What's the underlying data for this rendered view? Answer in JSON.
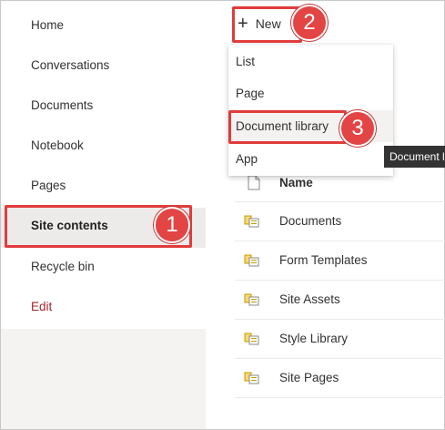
{
  "sidebar": {
    "items": [
      {
        "label": "Home"
      },
      {
        "label": "Conversations"
      },
      {
        "label": "Documents"
      },
      {
        "label": "Notebook"
      },
      {
        "label": "Pages"
      },
      {
        "label": "Site contents",
        "active": true
      },
      {
        "label": "Recycle bin"
      }
    ],
    "edit_label": "Edit"
  },
  "toolbar": {
    "new_label": "New",
    "new_icon": "plus-icon"
  },
  "new_menu": {
    "items": [
      {
        "label": "List"
      },
      {
        "label": "Page"
      },
      {
        "label": "Document library",
        "hovered": true
      },
      {
        "label": "App"
      }
    ]
  },
  "tooltip": {
    "text": "Document library"
  },
  "list": {
    "header": "Name",
    "rows": [
      {
        "name": "Documents",
        "icon": "library-icon"
      },
      {
        "name": "Form Templates",
        "icon": "library-icon"
      },
      {
        "name": "Site Assets",
        "icon": "library-icon"
      },
      {
        "name": "Style Library",
        "icon": "library-icon"
      },
      {
        "name": "Site Pages",
        "icon": "library-icon"
      }
    ]
  },
  "annotations": {
    "badges": [
      "1",
      "2",
      "3"
    ],
    "color": "#e34444"
  }
}
